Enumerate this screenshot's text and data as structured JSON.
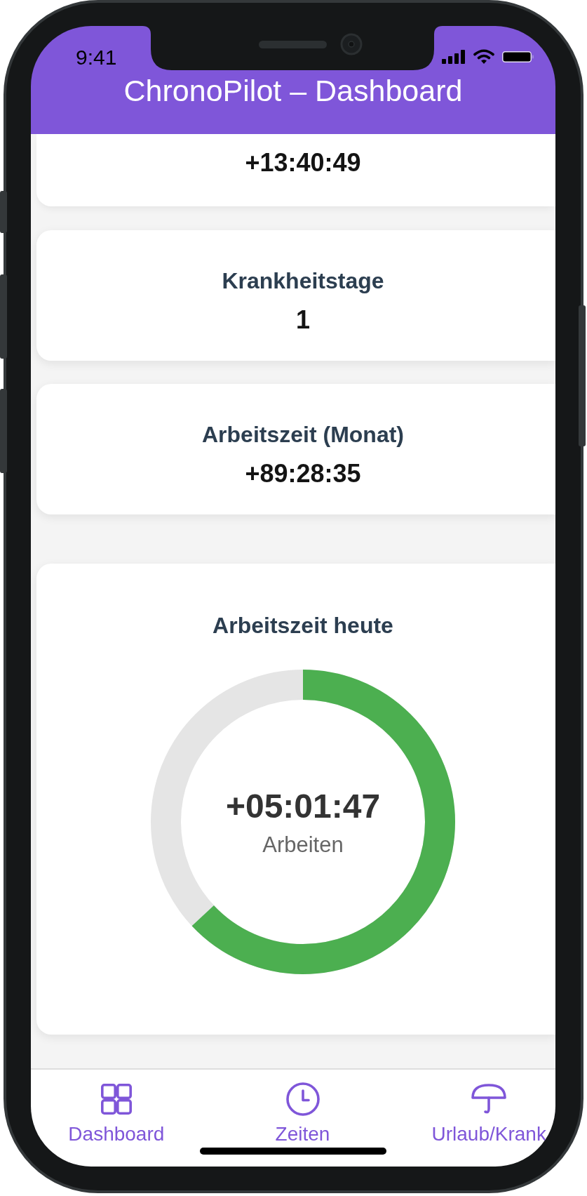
{
  "status_bar": {
    "time": "9:41"
  },
  "header": {
    "title": "ChronoPilot – Dashboard"
  },
  "summary_cards": [
    {
      "value": "+13:40:49"
    },
    {
      "label": "Krankheitstage",
      "value": "1"
    },
    {
      "label": "Arbeitszeit (Monat)",
      "value": "+89:28:35"
    }
  ],
  "today_card": {
    "title": "Arbeitszeit heute",
    "progress": {
      "level": 0.63,
      "value": "+05:01:47",
      "caption": "Arbeiten"
    }
  },
  "bottom_nav": [
    {
      "label": "Dashboard"
    },
    {
      "label": "Zeiten"
    },
    {
      "label": "Urlaub/Krank"
    }
  ]
}
